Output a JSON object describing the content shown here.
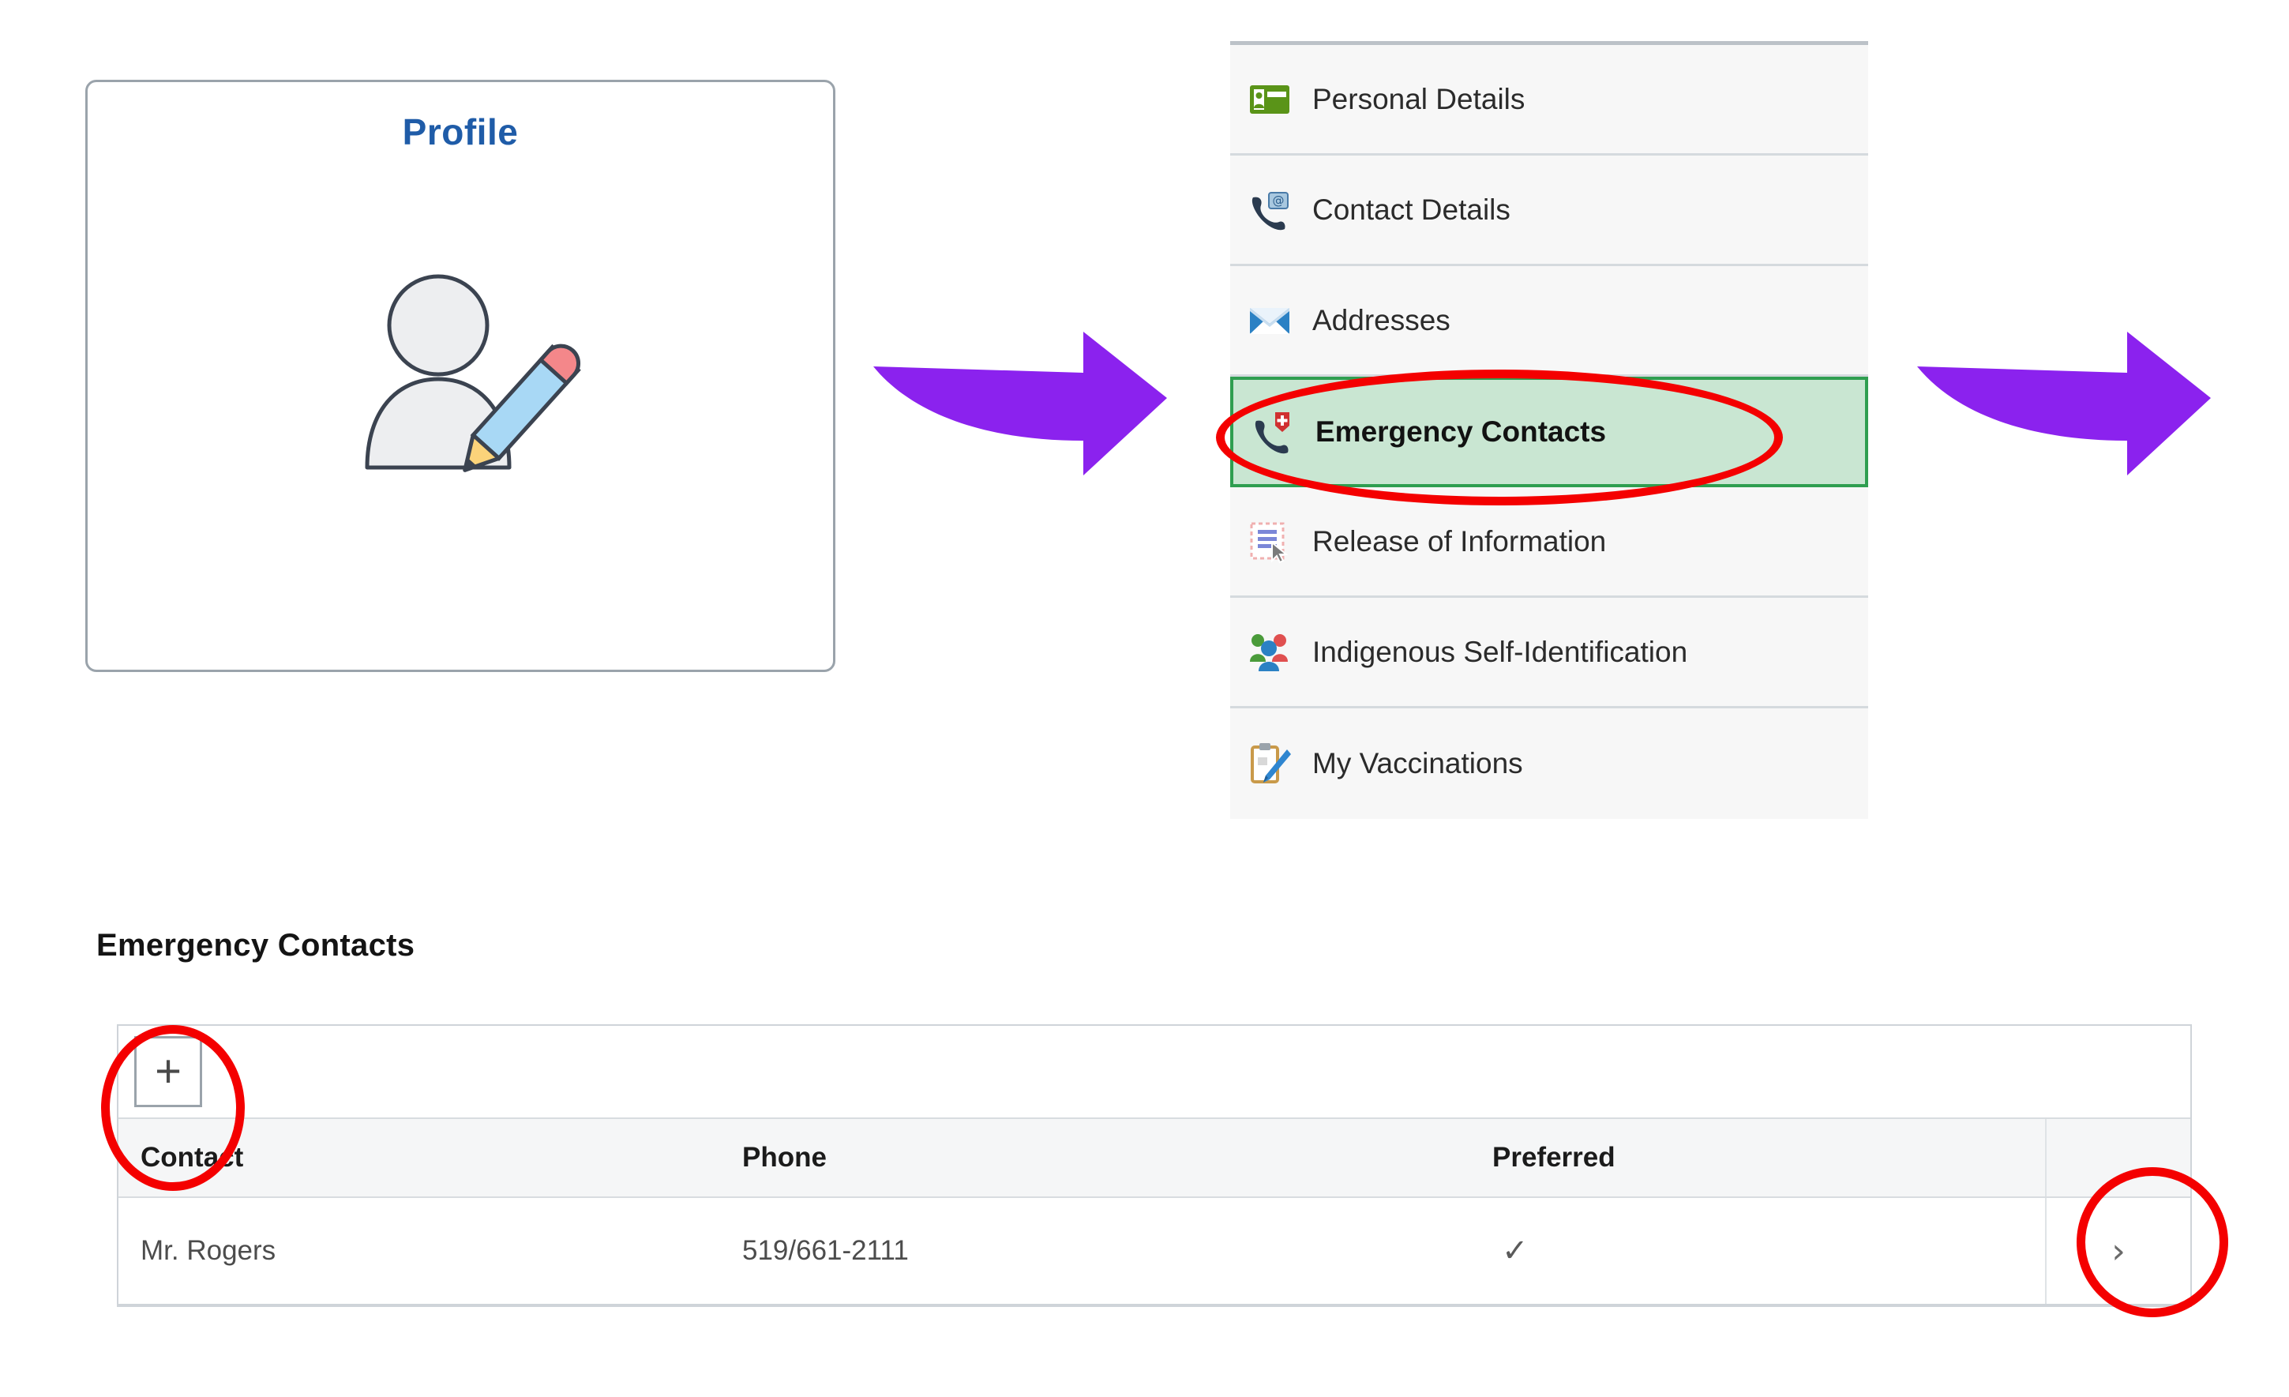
{
  "profile_tile": {
    "title": "Profile",
    "icon": "person-edit-icon"
  },
  "menu": {
    "items": [
      {
        "label": "Personal Details",
        "icon": "id-card-icon",
        "selected": false
      },
      {
        "label": "Contact Details",
        "icon": "phone-at-icon",
        "selected": false
      },
      {
        "label": "Addresses",
        "icon": "envelope-icon",
        "selected": false
      },
      {
        "label": "Emergency Contacts",
        "icon": "phone-medical-icon",
        "selected": true
      },
      {
        "label": "Release of Information",
        "icon": "document-cursor-icon",
        "selected": false
      },
      {
        "label": "Indigenous Self-Identification",
        "icon": "people-group-icon",
        "selected": false
      },
      {
        "label": "My Vaccinations",
        "icon": "clipboard-pen-icon",
        "selected": false
      }
    ]
  },
  "arrows": {
    "icon": "right-arrow-icon",
    "color": "#8b22ee",
    "count": 2
  },
  "contacts_section": {
    "heading": "Emergency Contacts",
    "toolbar": {
      "add_label": "+",
      "add_icon": "plus-icon"
    },
    "columns": [
      "Contact",
      "Phone",
      "Preferred",
      ""
    ],
    "rows": [
      {
        "contact": "Mr. Rogers",
        "phone": "519/661-2111",
        "preferred": "✓",
        "chevron": "›",
        "chevron_icon": "chevron-right-icon"
      }
    ]
  },
  "annotations": {
    "highlight_color": "#f40000",
    "rings": [
      "emergency-contacts-menu-item",
      "add-contact-button",
      "row-detail-chevron"
    ]
  }
}
